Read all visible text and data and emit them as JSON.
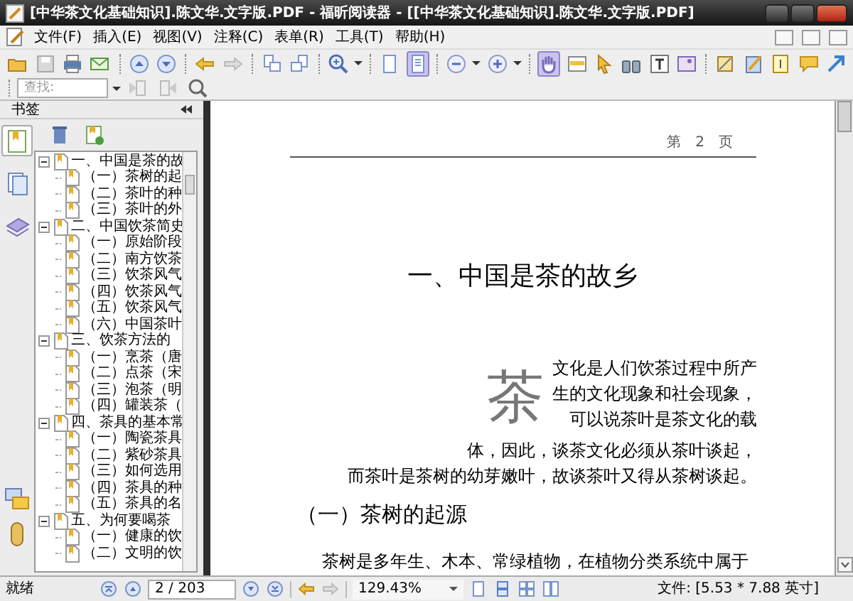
{
  "window": {
    "title": "[中华茶文化基础知识].陈文华.文字版.PDF - 福昕阅读器 - [[中华茶文化基础知识].陈文华.文字版.PDF]"
  },
  "menu": [
    "文件(F)",
    "插入(E)",
    "视图(V)",
    "注释(C)",
    "表单(R)",
    "工具(T)",
    "帮助(H)"
  ],
  "toolbar": {
    "single_page_selected": true,
    "hand_tool_selected": true
  },
  "search": {
    "placeholder": "查找:"
  },
  "sidebar": {
    "title": "书签",
    "tabs": [
      {
        "selected": true
      },
      {
        "selected": false
      },
      {
        "selected": false
      }
    ],
    "tree": [
      {
        "label": "一、中国是茶的故",
        "expanded": true,
        "children": [
          {
            "label": "（一）茶树的起"
          },
          {
            "label": "（二）茶叶的种"
          },
          {
            "label": "（三）茶叶的外"
          }
        ]
      },
      {
        "label": "二、中国饮茶简史",
        "expanded": true,
        "children": [
          {
            "label": "（一）原始阶段"
          },
          {
            "label": "（二）南方饮茶"
          },
          {
            "label": "（三）饮茶风气"
          },
          {
            "label": "（四）饮茶风气"
          },
          {
            "label": "（五）饮茶风气"
          },
          {
            "label": "（六）中国茶叶"
          }
        ]
      },
      {
        "label": "三、饮茶方法的",
        "expanded": true,
        "children": [
          {
            "label": "（一）烹茶（唐"
          },
          {
            "label": "（二）点茶（宋"
          },
          {
            "label": "（三）泡茶（明"
          },
          {
            "label": "（四）罐装茶（"
          }
        ]
      },
      {
        "label": "四、茶具的基本常",
        "expanded": true,
        "children": [
          {
            "label": "（一）陶瓷茶具"
          },
          {
            "label": "（二）紫砂茶具"
          },
          {
            "label": "（三）如何选用"
          },
          {
            "label": "（四）茶具的种"
          },
          {
            "label": "（五）茶具的名"
          }
        ]
      },
      {
        "label": "五、为何要喝茶",
        "expanded": true,
        "children": [
          {
            "label": "（一）健康的饮"
          },
          {
            "label": "（二）文明的饮"
          }
        ]
      }
    ]
  },
  "page": {
    "header": "第　2　页",
    "title": "一、中国是茶的故乡",
    "drop_cap": "茶",
    "intro_lines": [
      "文化是人们饮茶过程中所产",
      "生的文化现象和社会现象，",
      "可以说茶叶是茶文化的载",
      "体，因此，谈茶文化必须从茶叶谈起，",
      "而茶叶是茶树的幼芽嫩叶，故谈茶叶又得从茶树谈起。"
    ],
    "section": "（一）茶树的起源",
    "body": [
      "茶树是多年生、木本、常绿植物，在植物分类系统中属于"
    ]
  },
  "status_bar": {
    "status": "就绪",
    "page_field": "2 / 203",
    "zoom": "129.43%",
    "file_size": "文件: [5.53 * 7.88 英寸]"
  }
}
